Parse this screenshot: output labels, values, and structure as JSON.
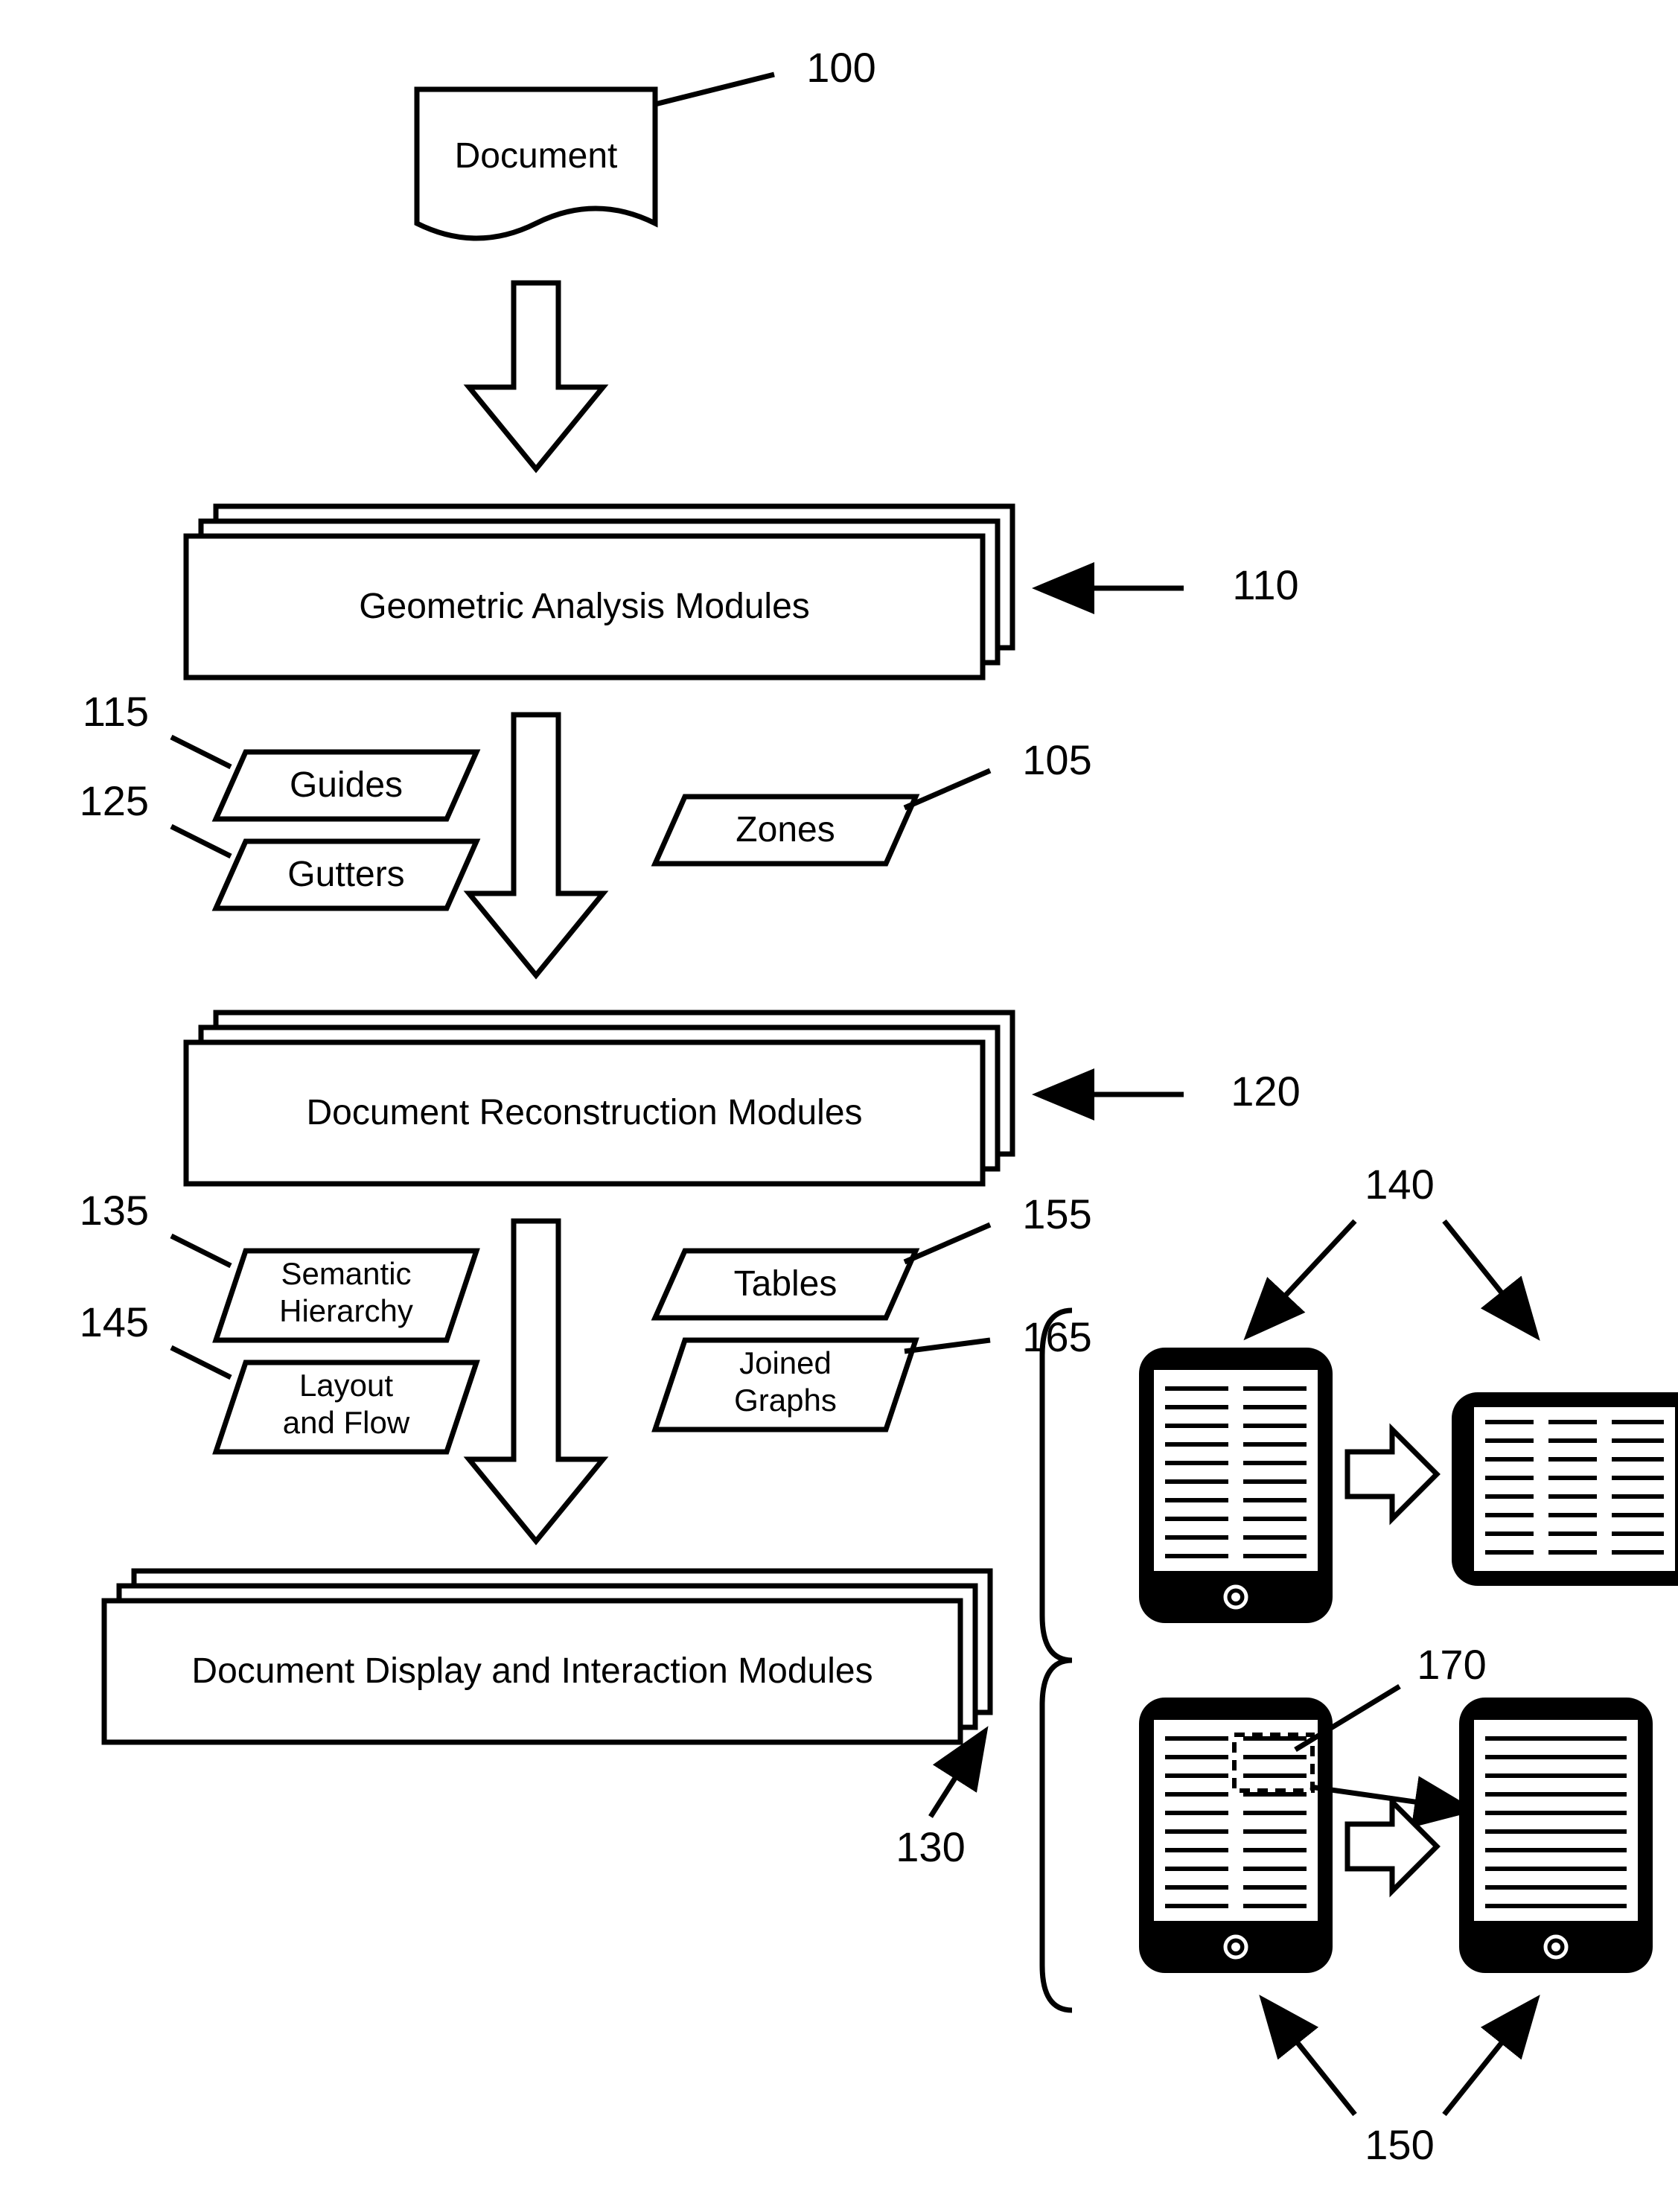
{
  "refs": {
    "r100": "100",
    "r105": "105",
    "r110": "110",
    "r115": "115",
    "r120": "120",
    "r125": "125",
    "r130": "130",
    "r135": "135",
    "r140": "140",
    "r145": "145",
    "r150": "150",
    "r155": "155",
    "r165": "165",
    "r170": "170"
  },
  "labels": {
    "document": "Document",
    "geom_modules": "Geometric Analysis Modules",
    "guides": "Guides",
    "gutters": "Gutters",
    "zones": "Zones",
    "recon_modules": "Document Reconstruction Modules",
    "semantic1": "Semantic",
    "semantic2": "Hierarchy",
    "layout1": "Layout",
    "layout2": "and Flow",
    "tables": "Tables",
    "joined1": "Joined",
    "joined2": "Graphs",
    "display_modules": "Document Display and Interaction Modules"
  }
}
